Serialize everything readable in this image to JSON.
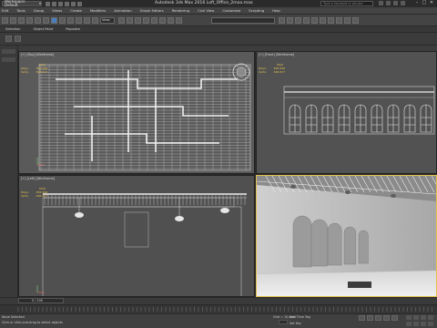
{
  "app": {
    "title": "Autodesk 3ds Max 2016    Loft_Office_2max.max",
    "workspace": "Workspace: Default",
    "search_placeholder": "Type a keyword or phrase"
  },
  "menu": [
    "Edit",
    "Tools",
    "Group",
    "Views",
    "Create",
    "Modifiers",
    "Animation",
    "Graph Editors",
    "Rendering",
    "Civil View",
    "Customize",
    "Scripting",
    "Help"
  ],
  "toolbar": {
    "view_select": "View"
  },
  "ribbon": {
    "tabs": [
      "Selection",
      "Object Paint",
      "Populate"
    ]
  },
  "viewports": {
    "top": {
      "label": "[+] [Top] [Wireframe]",
      "stats": {
        "header": "Total",
        "polys_label": "Polys:",
        "polys_value": "836 996",
        "verts_label": "Verts:",
        "verts_value": "696 817"
      }
    },
    "front": {
      "label": "[+] [Front] [Wireframe]",
      "stats": {
        "header": "Total",
        "polys_label": "Polys:",
        "polys_value": "836 996",
        "verts_label": "Verts:",
        "verts_value": "696 817"
      }
    },
    "left": {
      "label": "[+] [Left] [Wireframe]",
      "stats": {
        "header": "Total",
        "polys_label": "Polys:",
        "polys_value": "836 996",
        "verts_label": "Verts:",
        "verts_value": "696 817"
      }
    },
    "perspective": {
      "label": ""
    }
  },
  "timeline": {
    "frames": "0 / 100"
  },
  "status": {
    "selection": "None Selected",
    "prompt": "Click or click-and-drag to select objects",
    "grid": "Grid = 10,0cm",
    "add_time_tag": "Add Time Tag",
    "set_key": "Set Key"
  },
  "colors": {
    "active_border": "#e2c14a",
    "stats": "#e6c04c",
    "wire": "#cfcfcf"
  }
}
